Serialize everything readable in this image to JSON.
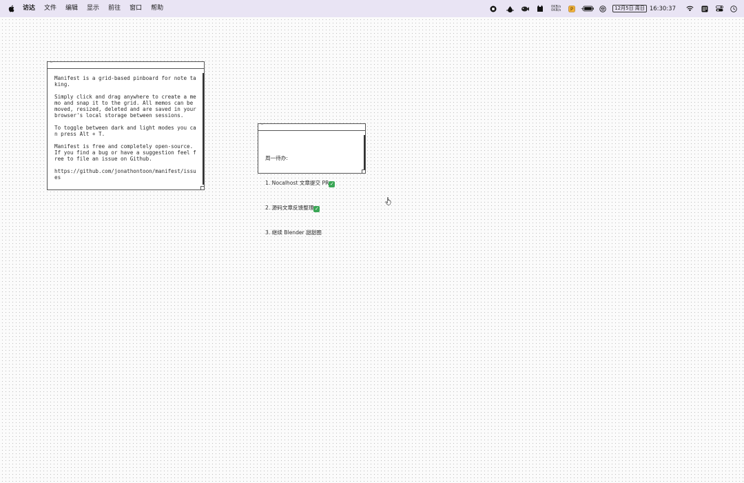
{
  "menubar": {
    "app_name": "访达",
    "items": [
      "文件",
      "编辑",
      "显示",
      "前往",
      "窗口",
      "帮助"
    ],
    "status": {
      "net_up": "0KB/s",
      "net_down": "0KB/s",
      "date": "12月5日 周日",
      "time": "16:30:37"
    }
  },
  "memos": [
    {
      "text": "Manifest is a grid-based pinboard for note taking.\n\nSimply click and drag anywhere to create a memo and snap it to the grid. All memos can be moved, resized, deleted and are saved in your browser's local storage between sessions.\n\nTo toggle between dark and light modes you can press Alt + T.\n\nManifest is free and completely open-source. If you find a bug or have a suggestion feel free to file an issue on Github.\n\nhttps://github.com/jonathontoon/manifest/issues"
    },
    {
      "heading": "周一待办:",
      "lines": [
        "1. Nocalhost 文章提交 PR",
        "2. 源码文章反馈整理",
        "3. 继续 Blender 甜甜圈"
      ],
      "check_emoji": "✓"
    }
  ],
  "colors": {
    "menubar_bg": "#e9e4f4",
    "canvas_bg": "#fbfbfb",
    "grid_dot": "#bdbdbd",
    "memo_border": "#555555",
    "check_green": "#3aa655"
  }
}
